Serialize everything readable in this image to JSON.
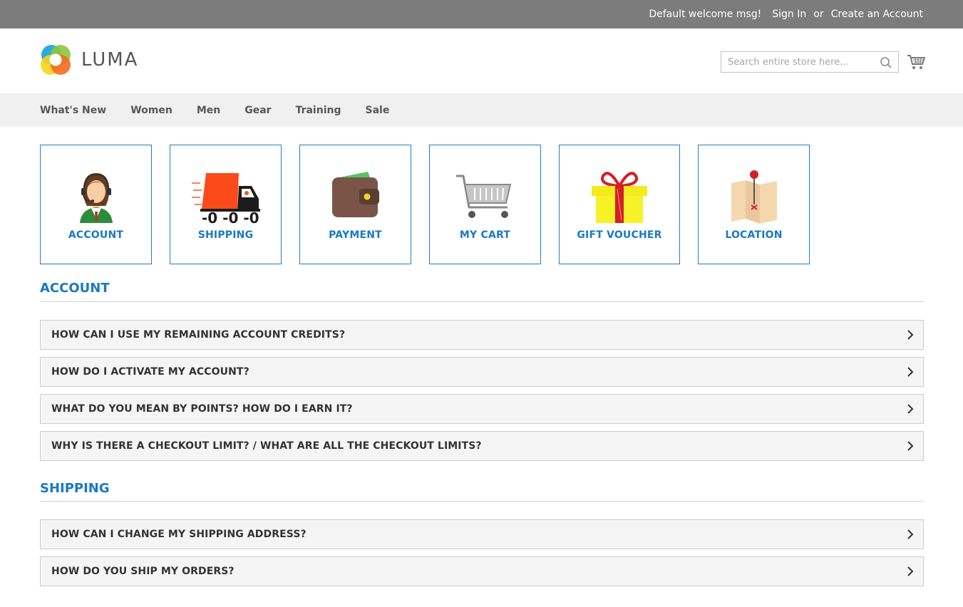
{
  "topbar": {
    "welcome": "Default welcome msg!",
    "sign_in": "Sign In",
    "or": "or",
    "create_account": "Create an Account"
  },
  "header": {
    "logo_text": "LUMA",
    "search_placeholder": "Search entire store here...",
    "search_icon": "search-icon",
    "cart_icon": "cart-icon"
  },
  "nav": {
    "items": [
      {
        "label": "What's New"
      },
      {
        "label": "Women"
      },
      {
        "label": "Men"
      },
      {
        "label": "Gear"
      },
      {
        "label": "Training"
      },
      {
        "label": "Sale"
      }
    ]
  },
  "categories": [
    {
      "label": "ACCOUNT",
      "icon": "support-agent-icon"
    },
    {
      "label": "SHIPPING",
      "icon": "delivery-truck-icon"
    },
    {
      "label": "PAYMENT",
      "icon": "wallet-icon"
    },
    {
      "label": "MY CART",
      "icon": "shopping-cart-icon"
    },
    {
      "label": "GIFT VOUCHER",
      "icon": "gift-icon"
    },
    {
      "label": "LOCATION",
      "icon": "map-pin-icon"
    }
  ],
  "sections": [
    {
      "title": "ACCOUNT",
      "questions": [
        "HOW CAN I USE MY REMAINING ACCOUNT CREDITS?",
        "HOW DO I ACTIVATE MY ACCOUNT?",
        "WHAT DO YOU MEAN BY POINTS? HOW DO I EARN IT?",
        "WHY IS THERE A CHECKOUT LIMIT? / WHAT ARE ALL THE CHECKOUT LIMITS?"
      ]
    },
    {
      "title": "SHIPPING",
      "questions": [
        "HOW CAN I CHANGE MY SHIPPING ADDRESS?",
        "HOW DO YOU SHIP MY ORDERS?"
      ]
    }
  ],
  "colors": {
    "accent": "#1979c3",
    "topbar": "#7b7c7b",
    "nav_bg": "#f0f0f0"
  }
}
